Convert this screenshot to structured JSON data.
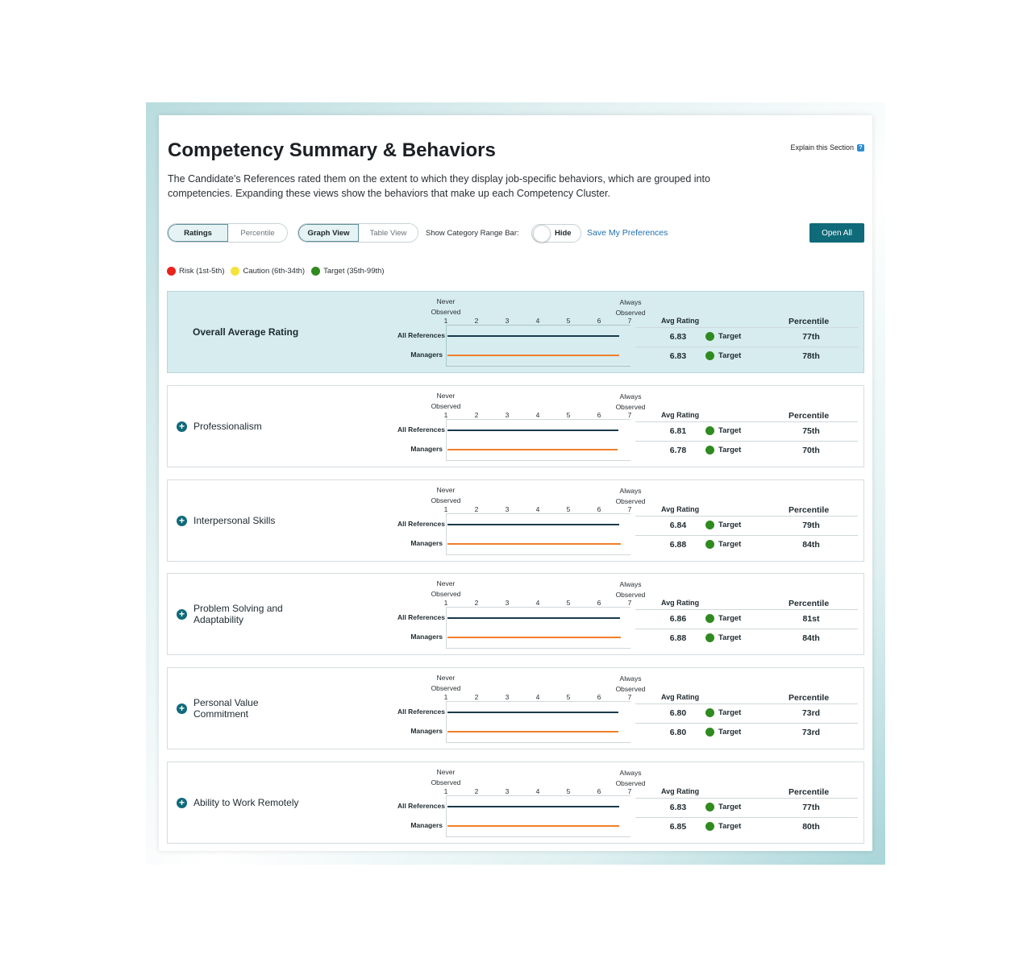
{
  "title": "Competency Summary & Behaviors",
  "explain_label": "Explain this Section",
  "description": "The Candidate's References rated them on the extent to which they display job-specific behaviors, which are grouped into competencies. Expanding these views show the behaviors that make up each Competency Cluster.",
  "controls": {
    "score_toggle": {
      "options": [
        "Ratings",
        "Percentile"
      ],
      "selected": "Ratings"
    },
    "view_toggle": {
      "options": [
        "Graph View",
        "Table View"
      ],
      "selected": "Graph View"
    },
    "range_bar_label": "Show Category Range Bar:",
    "range_bar_toggle_label": "Hide",
    "save_preferences": "Save My Preferences",
    "open_all": "Open All"
  },
  "legend": [
    {
      "label": "Risk (1st-5th)",
      "color": "#e8231b"
    },
    {
      "label": "Caution (6th-34th)",
      "color": "#f6e33a"
    },
    {
      "label": "Target (35th-99th)",
      "color": "#2f8a1f"
    }
  ],
  "scale": {
    "never_label": "Never Observed",
    "always_label": "Always Observed",
    "ticks": [
      "1",
      "2",
      "3",
      "4",
      "5",
      "6",
      "7"
    ],
    "min": 1,
    "max": 7
  },
  "headers": {
    "avg_rating": "Avg Rating",
    "percentile": "Percentile"
  },
  "row_labels": {
    "all_references": "All References",
    "managers": "Managers"
  },
  "colors": {
    "all_references_line": "#1b3a4b",
    "managers_line": "#f07f2a",
    "accent": "#0f6a79",
    "target": "#2f8a1f"
  },
  "competencies": [
    {
      "name": "Overall Average Rating",
      "overall": true,
      "all": {
        "value": 6.83,
        "rating": "6.83",
        "status": "Target",
        "percentile": "77th"
      },
      "managers": {
        "value": 6.83,
        "rating": "6.83",
        "status": "Target",
        "percentile": "78th"
      }
    },
    {
      "name": "Professionalism",
      "all": {
        "value": 6.81,
        "rating": "6.81",
        "status": "Target",
        "percentile": "75th"
      },
      "managers": {
        "value": 6.78,
        "rating": "6.78",
        "status": "Target",
        "percentile": "70th"
      }
    },
    {
      "name": "Interpersonal Skills",
      "all": {
        "value": 6.84,
        "rating": "6.84",
        "status": "Target",
        "percentile": "79th"
      },
      "managers": {
        "value": 6.88,
        "rating": "6.88",
        "status": "Target",
        "percentile": "84th"
      }
    },
    {
      "name": "Problem Solving and Adaptability",
      "all": {
        "value": 6.86,
        "rating": "6.86",
        "status": "Target",
        "percentile": "81st"
      },
      "managers": {
        "value": 6.88,
        "rating": "6.88",
        "status": "Target",
        "percentile": "84th"
      }
    },
    {
      "name": "Personal Value Commitment",
      "all": {
        "value": 6.8,
        "rating": "6.80",
        "status": "Target",
        "percentile": "73rd"
      },
      "managers": {
        "value": 6.8,
        "rating": "6.80",
        "status": "Target",
        "percentile": "73rd"
      }
    },
    {
      "name": "Ability to Work Remotely",
      "all": {
        "value": 6.83,
        "rating": "6.83",
        "status": "Target",
        "percentile": "77th"
      },
      "managers": {
        "value": 6.85,
        "rating": "6.85",
        "status": "Target",
        "percentile": "80th"
      }
    }
  ]
}
